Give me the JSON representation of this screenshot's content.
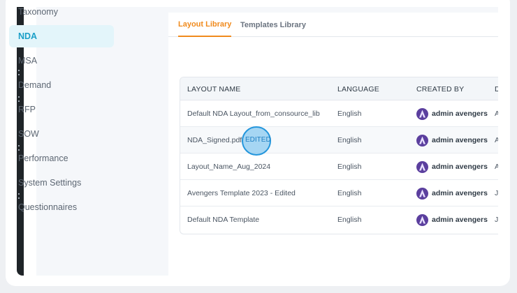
{
  "sidebar": {
    "items": [
      {
        "label": "Taxonomy",
        "active": false
      },
      {
        "label": "NDA",
        "active": true
      },
      {
        "label": "MSA",
        "active": false
      },
      {
        "label": "Demand",
        "active": false
      },
      {
        "label": "RFP",
        "active": false
      },
      {
        "label": "SOW",
        "active": false
      },
      {
        "label": "Performance",
        "active": false
      },
      {
        "label": "System Settings",
        "active": false
      },
      {
        "label": "Questionnaires",
        "active": false
      }
    ]
  },
  "tabs": [
    {
      "label": "Layout Library",
      "active": true
    },
    {
      "label": "Templates Library",
      "active": false
    }
  ],
  "table": {
    "headers": [
      "LAYOUT NAME",
      "LANGUAGE",
      "CREATED BY",
      "D"
    ],
    "rows": [
      {
        "name": "Default NDA Layout_from_consource_lib",
        "language": "English",
        "created_by": "admin avengers",
        "extra": "A"
      },
      {
        "name": "NDA_Signed.pdf",
        "badge": "EDITED",
        "language": "English",
        "created_by": "admin avengers",
        "extra": "A"
      },
      {
        "name": "Layout_Name_Aug_2024",
        "language": "English",
        "created_by": "admin avengers",
        "extra": "A"
      },
      {
        "name": "Avengers Template 2023 - Edited",
        "language": "English",
        "created_by": "admin avengers",
        "extra": "J"
      },
      {
        "name": "Default NDA Template",
        "language": "English",
        "created_by": "admin avengers",
        "extra": "J"
      }
    ]
  },
  "colors": {
    "accent": "#f08a1c",
    "active_nav": "#1a9fc7",
    "highlight": "#2496dc"
  }
}
